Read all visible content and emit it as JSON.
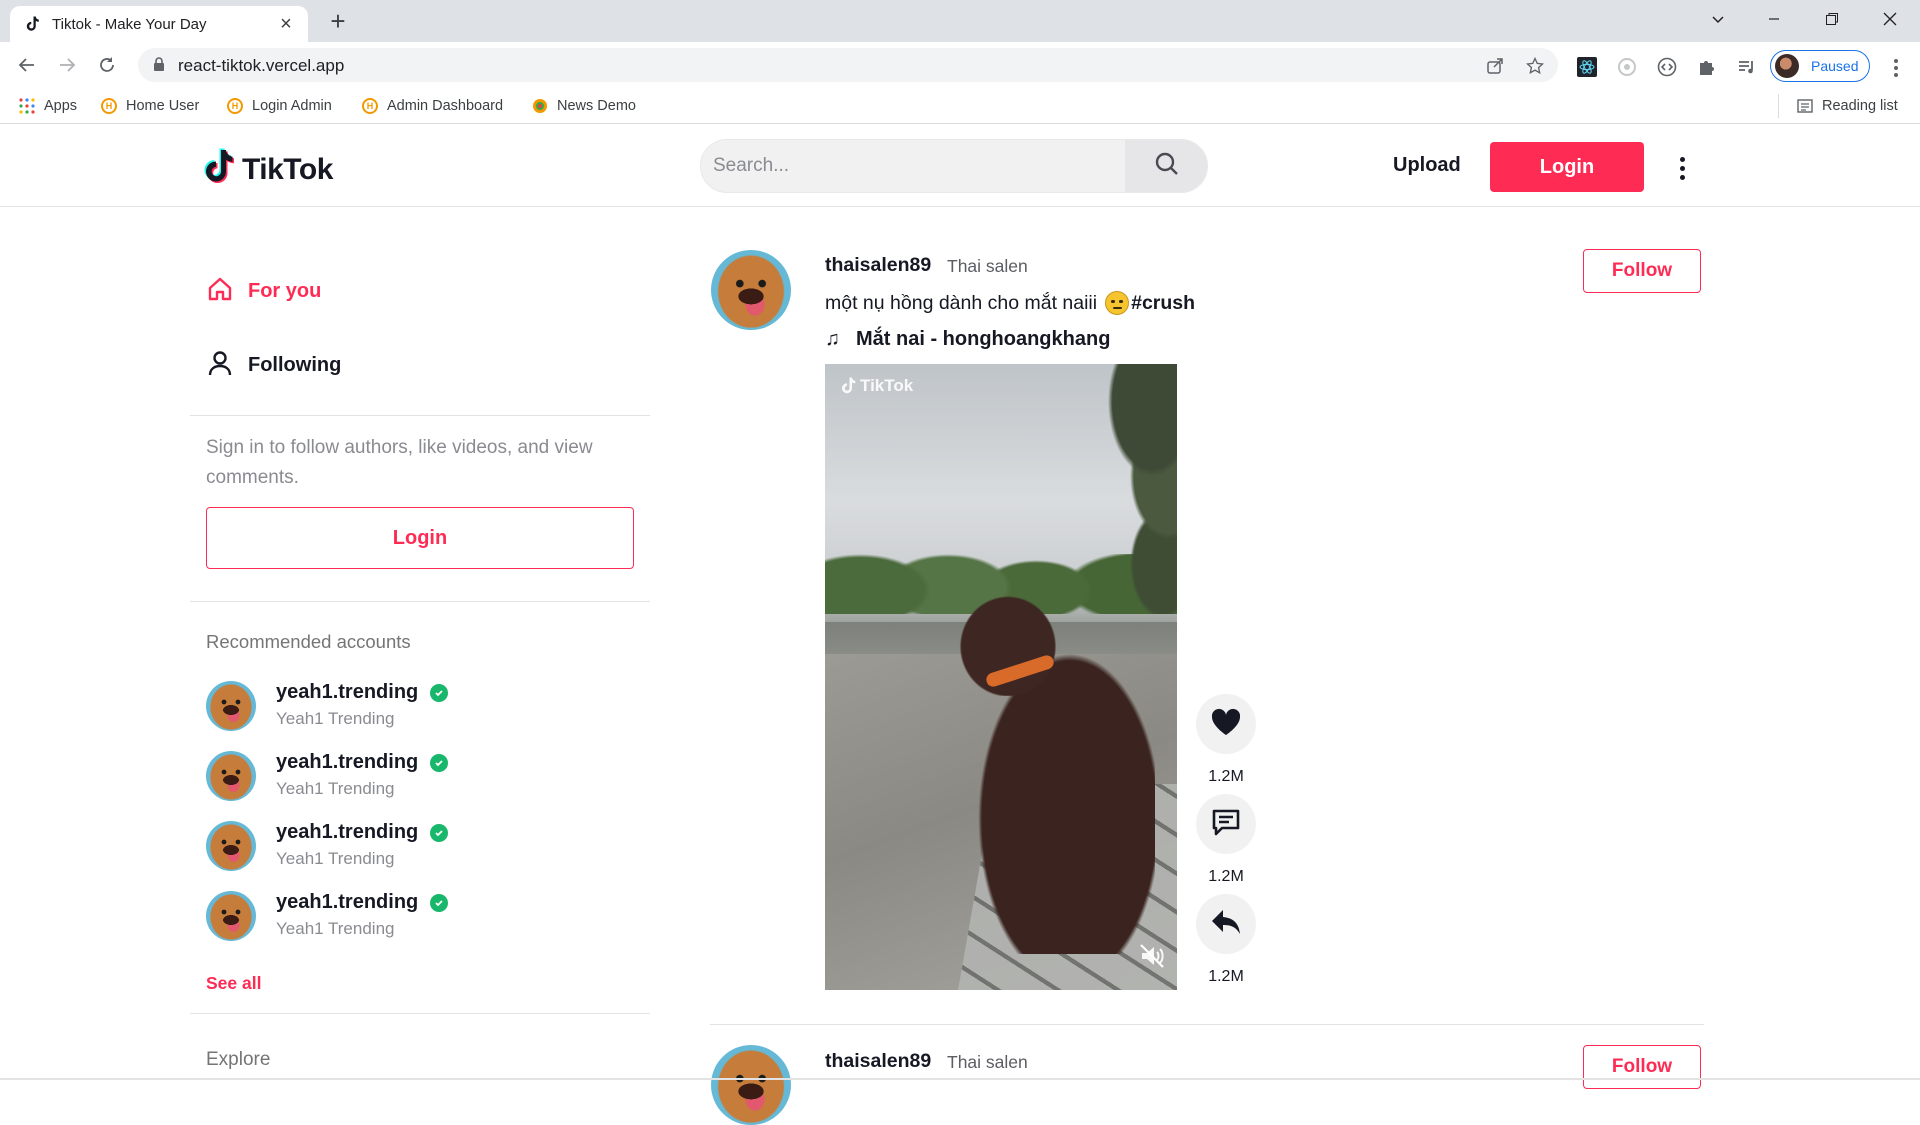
{
  "browser": {
    "tab_title": "Tiktok - Make Your Day",
    "url": "react-tiktok.vercel.app",
    "profile_status": "Paused",
    "bookmarks": [
      "Apps",
      "Home User",
      "Login Admin",
      "Admin Dashboard",
      "News Demo"
    ],
    "reading_list": "Reading list"
  },
  "header": {
    "logo_text": "TikTok",
    "search_placeholder": "Search...",
    "upload_label": "Upload",
    "login_label": "Login"
  },
  "sidebar": {
    "nav": [
      {
        "label": "For you",
        "icon": "home-icon",
        "active": true
      },
      {
        "label": "Following",
        "icon": "user-icon",
        "active": false
      }
    ],
    "signin_text": "Sign in to follow authors, like videos, and view comments.",
    "login_label": "Login",
    "recommended_title": "Recommended accounts",
    "accounts": [
      {
        "username": "yeah1.trending",
        "name": "Yeah1 Trending",
        "verified": true
      },
      {
        "username": "yeah1.trending",
        "name": "Yeah1 Trending",
        "verified": true
      },
      {
        "username": "yeah1.trending",
        "name": "Yeah1 Trending",
        "verified": true
      },
      {
        "username": "yeah1.trending",
        "name": "Yeah1 Trending",
        "verified": true
      }
    ],
    "see_all": "See all",
    "explore_title": "Explore"
  },
  "feed": {
    "posts": [
      {
        "username": "thaisalen89",
        "name": "Thai salen",
        "caption": "một nụ hồng dành cho mắt naiii",
        "hashtag": "#crush",
        "music": "Mắt nai - honghoangkhang",
        "follow_label": "Follow",
        "video_watermark": "TikTok",
        "likes": "1.2M",
        "comments": "1.2M",
        "shares": "1.2M"
      },
      {
        "username": "thaisalen89",
        "name": "Thai salen",
        "follow_label": "Follow"
      }
    ]
  },
  "colors": {
    "brand": "#fe2c55",
    "text": "#161823",
    "muted": "#8a8b91",
    "verified": "#19b76b"
  }
}
